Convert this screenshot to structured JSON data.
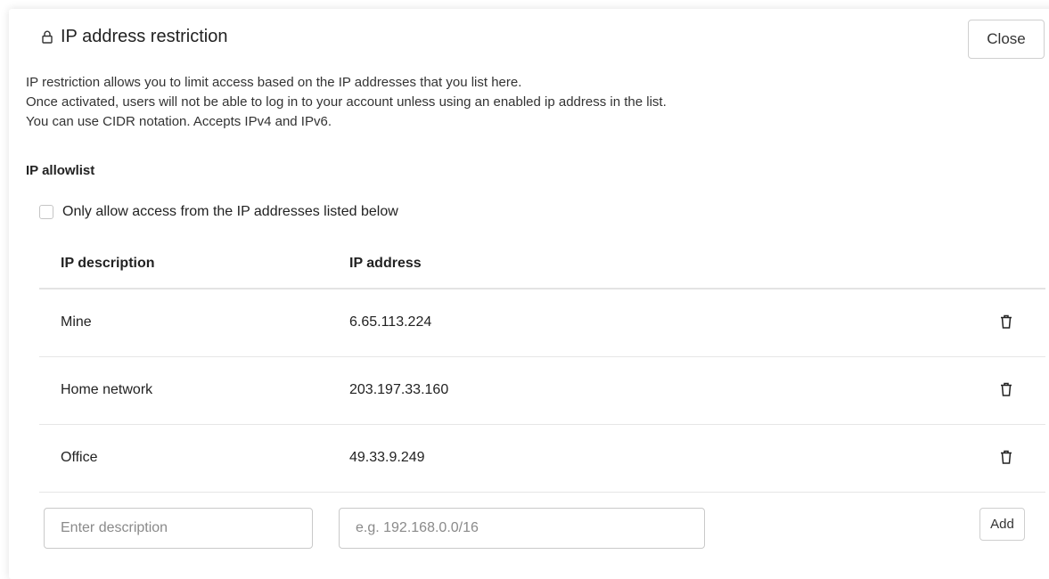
{
  "header": {
    "title": "IP address restriction",
    "lock_icon": "lock-icon",
    "close_label": "Close"
  },
  "description": {
    "lines": [
      "IP restriction allows you to limit access based on the IP addresses that you list here.",
      "Once activated, users will not be able to log in to your account unless using an enabled ip address in the list.",
      "You can use CIDR notation. Accepts IPv4 and IPv6."
    ]
  },
  "allowlist": {
    "title": "IP allowlist",
    "checkbox_label": "Only allow access from the IP addresses listed below",
    "checkbox_checked": false
  },
  "table": {
    "columns": [
      "IP description",
      "IP address"
    ],
    "rows": [
      {
        "description": "Mine",
        "address": "6.65.113.224",
        "delete_icon": "trash-icon"
      },
      {
        "description": "Home network",
        "address": "203.197.33.160",
        "delete_icon": "trash-icon"
      },
      {
        "description": "Office",
        "address": "49.33.9.249",
        "delete_icon": "trash-icon"
      }
    ]
  },
  "form": {
    "description_value": "",
    "description_placeholder": "Enter description",
    "address_value": "",
    "address_placeholder": "e.g. 192.168.0.0/16",
    "add_label": "Add"
  }
}
